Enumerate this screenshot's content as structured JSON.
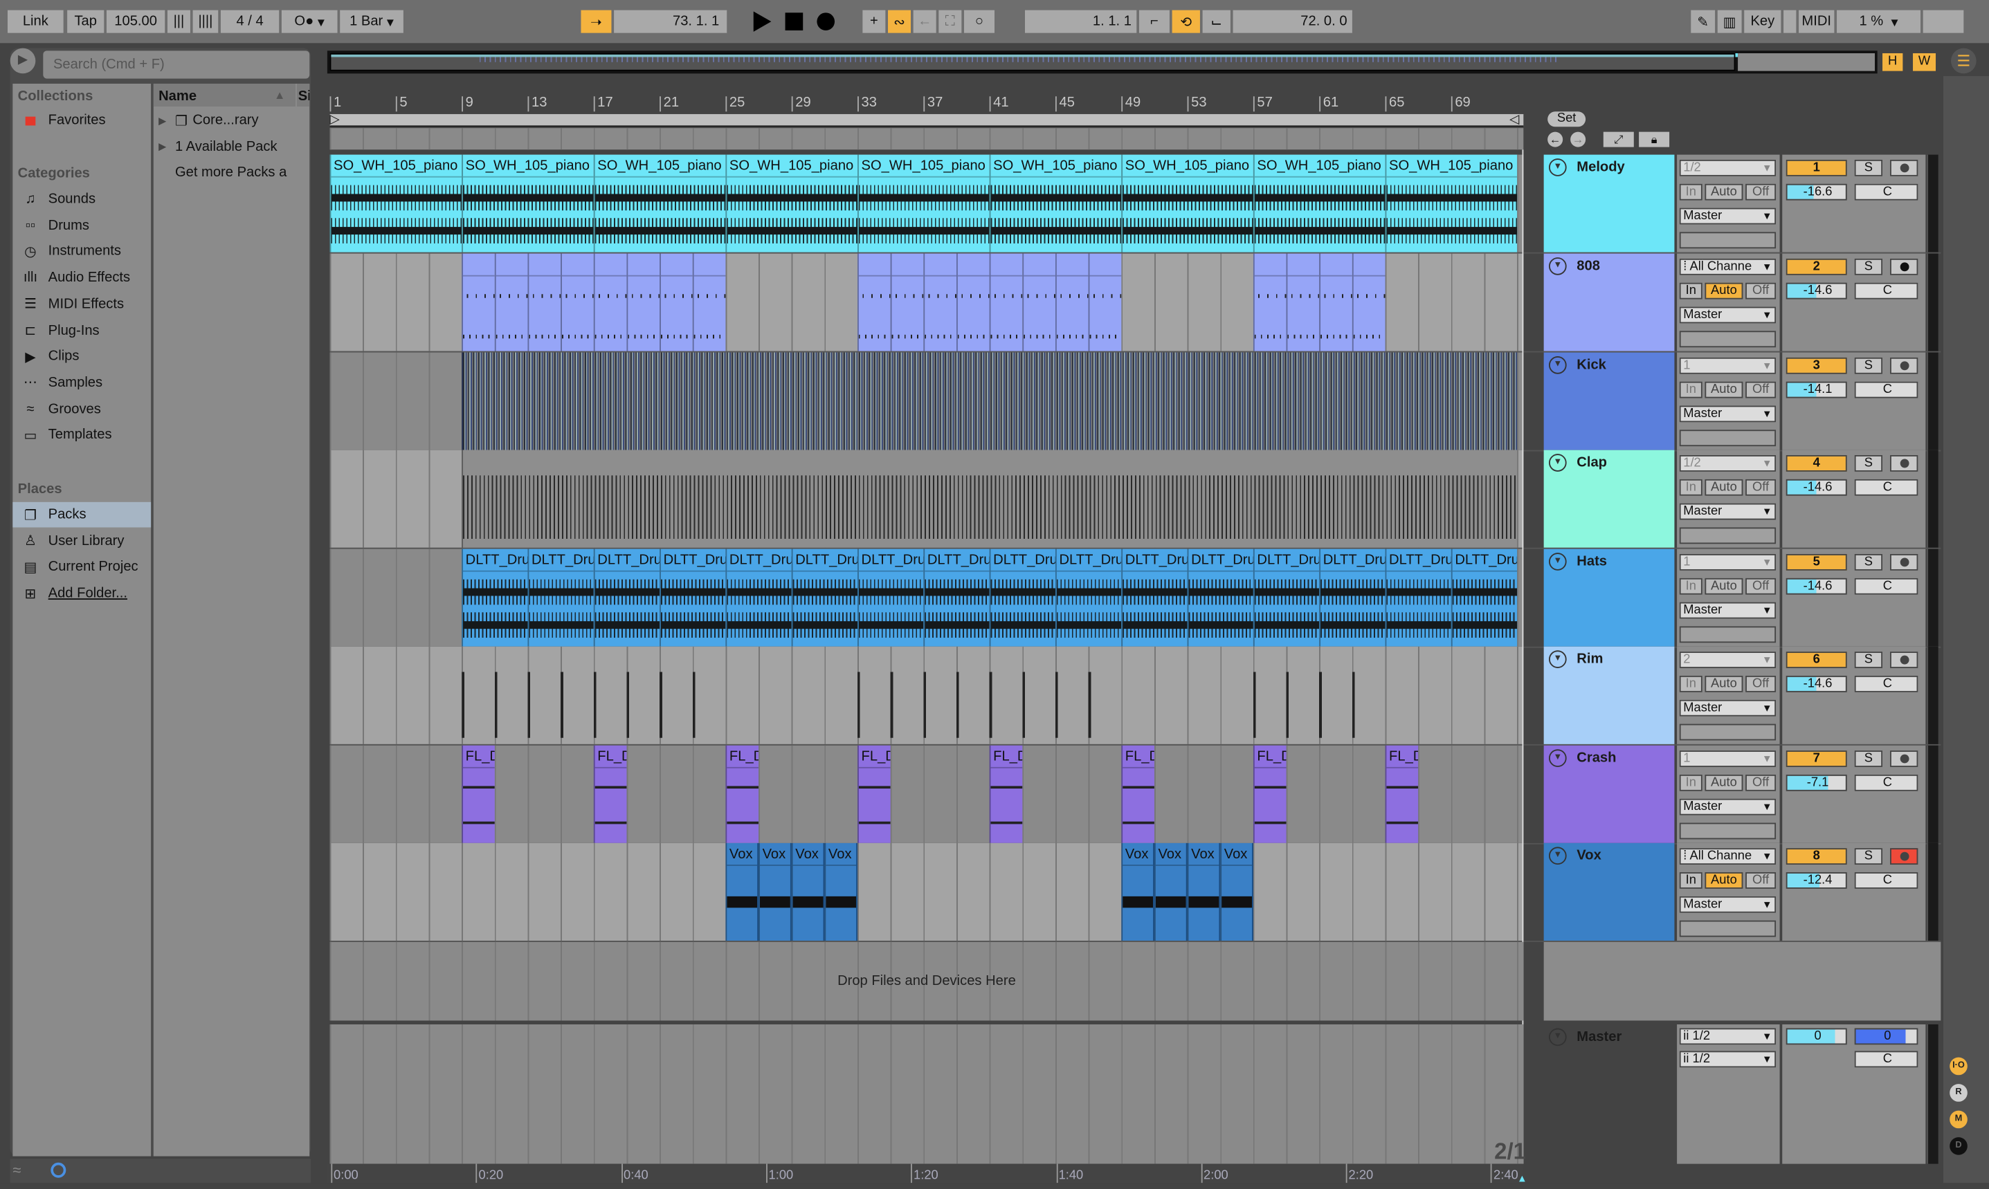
{
  "toolbar": {
    "link": "Link",
    "tap": "Tap",
    "tempo": "105.00",
    "time_sig": "4 / 4",
    "metronome": "O●",
    "quantize": "1 Bar",
    "position": "73.  1.  1",
    "loop_start": "1.  1.  1",
    "loop_length": "72.  0.  0",
    "key": "Key",
    "midi": "MIDI",
    "cpu": "1 %"
  },
  "browser": {
    "search_placeholder": "Search (Cmd + F)",
    "collections_title": "Collections",
    "favorites": "Favorites",
    "categories_title": "Categories",
    "categories": [
      {
        "label": "Sounds",
        "icon": "♫"
      },
      {
        "label": "Drums",
        "icon": "▫▫"
      },
      {
        "label": "Instruments",
        "icon": "◷"
      },
      {
        "label": "Audio Effects",
        "icon": "ıllı"
      },
      {
        "label": "MIDI Effects",
        "icon": "☰"
      },
      {
        "label": "Plug-Ins",
        "icon": "⊏"
      },
      {
        "label": "Clips",
        "icon": "▶"
      },
      {
        "label": "Samples",
        "icon": "⋯"
      },
      {
        "label": "Grooves",
        "icon": "≈"
      },
      {
        "label": "Templates",
        "icon": "▭"
      }
    ],
    "places_title": "Places",
    "places": [
      {
        "label": "Packs",
        "icon": "❐",
        "selected": true
      },
      {
        "label": "User Library",
        "icon": "♙"
      },
      {
        "label": "Current Projec",
        "icon": "▤"
      },
      {
        "label": "Add Folder...",
        "icon": "⊞"
      }
    ],
    "col_name": "Name",
    "col_size": "Si",
    "items": [
      {
        "label": "Core...rary",
        "expand": true,
        "icon": "❐"
      },
      {
        "label": "1 Available Pack",
        "expand": true
      },
      {
        "label": "Get more Packs a",
        "expand": false
      }
    ]
  },
  "ruler": {
    "bars": [
      "1",
      "5",
      "9",
      "13",
      "17",
      "21",
      "25",
      "29",
      "33",
      "37",
      "41",
      "45",
      "49",
      "53",
      "57",
      "61",
      "65",
      "69"
    ]
  },
  "time_ruler": [
    "0:00",
    "0:20",
    "0:40",
    "1:00",
    "1:20",
    "1:40",
    "2:00",
    "2:20",
    "2:40"
  ],
  "set_label": "Set",
  "drop_text": "Drop Files and Devices Here",
  "grid_label": "2/1",
  "tracks": [
    {
      "name": "Melody",
      "color": "#6de6f8",
      "clip_color": "#6de6f8",
      "kind": "audio",
      "clip_name": "SO_WH_105_piano",
      "clips": [
        [
          1,
          8
        ],
        [
          9,
          8
        ],
        [
          17,
          8
        ],
        [
          25,
          8
        ],
        [
          33,
          8
        ],
        [
          41,
          8
        ],
        [
          49,
          8
        ],
        [
          57,
          8
        ],
        [
          65,
          8
        ]
      ],
      "input": "1/2",
      "input_dim": true,
      "auto_on": false,
      "in_dim": true,
      "output": "Master",
      "number": "1",
      "volume": "-16.6",
      "vol_fill": 0.45,
      "pan": "C",
      "arm": "off"
    },
    {
      "name": "808",
      "color": "#96a5f7",
      "clip_color": "#96a5f7",
      "kind": "midi",
      "clip_name": "",
      "clips": [
        [
          9,
          2
        ],
        [
          11,
          2
        ],
        [
          13,
          2
        ],
        [
          15,
          2
        ],
        [
          17,
          2
        ],
        [
          19,
          2
        ],
        [
          21,
          2
        ],
        [
          23,
          2
        ],
        [
          33,
          2
        ],
        [
          35,
          2
        ],
        [
          37,
          2
        ],
        [
          39,
          2
        ],
        [
          41,
          2
        ],
        [
          43,
          2
        ],
        [
          45,
          2
        ],
        [
          47,
          2
        ],
        [
          57,
          2
        ],
        [
          59,
          2
        ],
        [
          61,
          2
        ],
        [
          63,
          2
        ]
      ],
      "input": "All Channe",
      "input_dim": false,
      "auto_on": true,
      "in_dim": false,
      "output": "Master",
      "number": "2",
      "volume": "-14.6",
      "vol_fill": 0.5,
      "pan": "C",
      "arm": "midi"
    },
    {
      "name": "Kick",
      "color": "#5b7fdc",
      "clip_color": "#4b68b8",
      "kind": "dense",
      "clip_name": "",
      "clips": [
        [
          9,
          64
        ]
      ],
      "input": "1",
      "input_dim": true,
      "auto_on": false,
      "in_dim": true,
      "output": "Master",
      "number": "3",
      "volume": "-14.1",
      "vol_fill": 0.5,
      "pan": "C",
      "arm": "off"
    },
    {
      "name": "Clap",
      "color": "#8df7de",
      "clip_color": "#7fd9c6",
      "kind": "sparse",
      "clip_name": "",
      "clips": [
        [
          9,
          64
        ]
      ],
      "input": "1/2",
      "input_dim": true,
      "auto_on": false,
      "in_dim": true,
      "output": "Master",
      "number": "4",
      "volume": "-14.6",
      "vol_fill": 0.5,
      "pan": "C",
      "arm": "off"
    },
    {
      "name": "Hats",
      "color": "#4aa6e8",
      "clip_color": "#4aa6e8",
      "kind": "audio",
      "clip_name": "DLTT_Dru",
      "clips": [
        [
          9,
          4
        ],
        [
          13,
          4
        ],
        [
          17,
          4
        ],
        [
          21,
          4
        ],
        [
          25,
          4
        ],
        [
          29,
          4
        ],
        [
          33,
          4
        ],
        [
          37,
          4
        ],
        [
          41,
          4
        ],
        [
          45,
          4
        ],
        [
          49,
          4
        ],
        [
          53,
          4
        ],
        [
          57,
          4
        ],
        [
          61,
          4
        ],
        [
          65,
          4
        ],
        [
          69,
          4
        ]
      ],
      "input": "1",
      "input_dim": true,
      "auto_on": false,
      "in_dim": true,
      "output": "Master",
      "number": "5",
      "volume": "-14.6",
      "vol_fill": 0.5,
      "pan": "C",
      "arm": "off"
    },
    {
      "name": "Rim",
      "color": "#a7cff8",
      "clip_color": "#9a9a9a",
      "kind": "rim",
      "clip_name": "",
      "clips": [
        [
          9,
          16
        ],
        [
          33,
          16
        ],
        [
          57,
          8
        ]
      ],
      "input": "2",
      "input_dim": true,
      "auto_on": false,
      "in_dim": true,
      "output": "Master",
      "number": "6",
      "volume": "-14.6",
      "vol_fill": 0.5,
      "pan": "C",
      "arm": "off"
    },
    {
      "name": "Crash",
      "color": "#8d6fe0",
      "clip_color": "#8d6fe0",
      "kind": "crash",
      "clip_name": "FL_D",
      "clips": [
        [
          9,
          2
        ],
        [
          17,
          2
        ],
        [
          25,
          2
        ],
        [
          33,
          2
        ],
        [
          41,
          2
        ],
        [
          49,
          2
        ],
        [
          57,
          2
        ],
        [
          65,
          2
        ]
      ],
      "input": "1",
      "input_dim": true,
      "auto_on": false,
      "in_dim": true,
      "output": "Master",
      "number": "7",
      "volume": "-7.1",
      "vol_fill": 0.7,
      "pan": "C",
      "arm": "off"
    },
    {
      "name": "Vox",
      "color": "#3a80c6",
      "clip_color": "#3a80c6",
      "kind": "vox",
      "clip_name": "Vox",
      "clips": [
        [
          25,
          2
        ],
        [
          27,
          2
        ],
        [
          29,
          2
        ],
        [
          31,
          2
        ],
        [
          49,
          2
        ],
        [
          51,
          2
        ],
        [
          53,
          2
        ],
        [
          55,
          2
        ]
      ],
      "input": "All Channe",
      "input_dim": false,
      "auto_on": true,
      "in_dim": false,
      "output": "Master",
      "number": "8",
      "volume": "-12.4",
      "vol_fill": 0.55,
      "pan": "C",
      "arm": "armed"
    }
  ],
  "io_labels": {
    "in": "In",
    "auto": "Auto",
    "off": "Off",
    "solo": "S"
  },
  "master": {
    "name": "Master",
    "color": "#f8f38e",
    "input1": "1/2",
    "input2": "1/2",
    "volume": "0",
    "cue": "0",
    "pan": "C"
  },
  "side_buttons": [
    {
      "label": "I·O",
      "color": "#f4b33f"
    },
    {
      "label": "R",
      "color": "#cfcfcf"
    },
    {
      "label": "M",
      "color": "#f4b33f"
    },
    {
      "label": "D",
      "color": "#111"
    }
  ],
  "overview": {
    "h": "H",
    "w": "W"
  }
}
